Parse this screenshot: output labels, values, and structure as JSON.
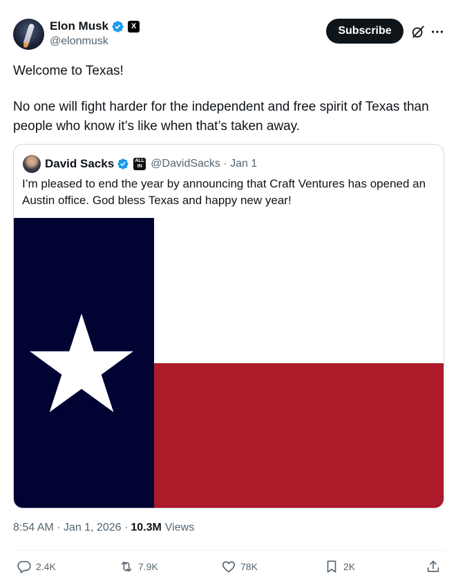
{
  "author": {
    "name": "Elon Musk",
    "handle": "@elonmusk",
    "affiliate_badge": "X"
  },
  "header": {
    "subscribe_label": "Subscribe",
    "icons": [
      "grok-icon",
      "more-icon"
    ]
  },
  "post": {
    "line1": "Welcome to Texas!",
    "line2": "No one will fight harder for the independent and free spirit of Texas than people who know it’s like when that’s taken away."
  },
  "quote": {
    "name": "David Sacks",
    "badge_text": [
      "ALL",
      "IN"
    ],
    "handle_date": "@DavidSacks · Jan 1",
    "text": "I’m pleased to end the year by announcing that Craft Ventures has opened an Austin office. God bless Texas and happy new year!",
    "image": {
      "subject": "texas-flag",
      "colors": {
        "blue": "#010433",
        "white": "#ffffff",
        "red": "#ad1a29"
      }
    }
  },
  "meta": {
    "timestamp": "8:54 AM · Jan 1, 2026 ·",
    "views_count": "10.3M",
    "views_label": "Views"
  },
  "actions": {
    "replies": "2.4K",
    "reposts": "7.9K",
    "likes": "78K",
    "bookmarks": "2K"
  },
  "colors": {
    "text": "#0f1419",
    "secondary": "#536471",
    "verified": "#1d9bf0",
    "border": "#cfd9de"
  }
}
